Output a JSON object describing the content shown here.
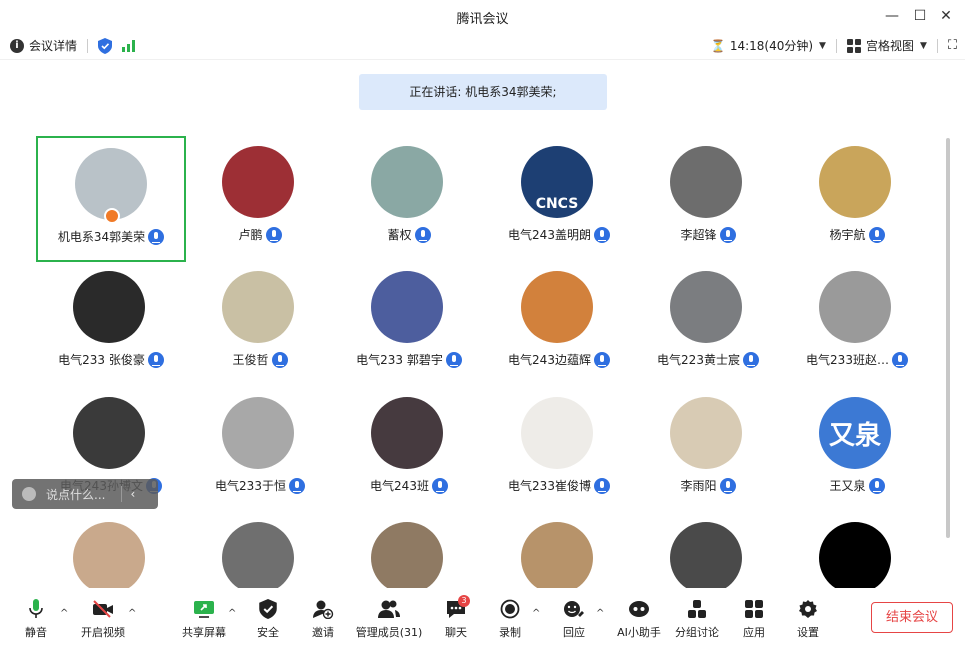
{
  "window": {
    "title": "腾讯会议",
    "minimize": "—",
    "maximize": "☐",
    "close": "✕"
  },
  "infobar": {
    "meeting_details": "会议详情",
    "timer": "14:18(40分钟)",
    "view_mode": "宫格视图"
  },
  "speaking_banner": "正在讲话: 机电系34郭美荣;",
  "participants": [
    {
      "name": "机电系34郭美荣",
      "avatar_color": "#b9c2c8",
      "host": true,
      "active": true
    },
    {
      "name": "卢鹏",
      "avatar_color": "#9d2f35"
    },
    {
      "name": "蓄权",
      "avatar_color": "#8aa8a4"
    },
    {
      "name": "电气243盖明朗",
      "avatar_color": "#1d3f73",
      "avatar_text": "CNCS"
    },
    {
      "name": "李超锋",
      "avatar_color": "#6d6d6d"
    },
    {
      "name": "杨宇航",
      "avatar_color": "#c9a55b"
    },
    {
      "name": "电气233 张俊豪",
      "avatar_color": "#2a2a2a"
    },
    {
      "name": "王俊哲",
      "avatar_color": "#c9c0a4"
    },
    {
      "name": "电气233 郭碧宇",
      "avatar_color": "#4d5e9e"
    },
    {
      "name": "电气243边蕴辉",
      "avatar_color": "#d2813c"
    },
    {
      "name": "电气223黄士宸",
      "avatar_color": "#7b7d80"
    },
    {
      "name": "电气233班赵…",
      "avatar_color": "#9a9a9a"
    },
    {
      "name": "电气243孙博文",
      "avatar_color": "#3a3a3a"
    },
    {
      "name": "电气233于恒",
      "avatar_color": "#a8a8a8"
    },
    {
      "name": "电气243班",
      "avatar_color": "#463a3f"
    },
    {
      "name": "电气233崔俊博",
      "avatar_color": "#eeece8"
    },
    {
      "name": "李雨阳",
      "avatar_color": "#d8cbb4"
    },
    {
      "name": "王又泉",
      "avatar_color": "#3c79d4",
      "avatar_text": "又泉"
    },
    {
      "name": "",
      "avatar_color": "#c9a98c"
    },
    {
      "name": "",
      "avatar_color": "#6f6f6f"
    },
    {
      "name": "",
      "avatar_color": "#8f7a63"
    },
    {
      "name": "",
      "avatar_color": "#b7936a"
    },
    {
      "name": "",
      "avatar_color": "#4a4a4a"
    },
    {
      "name": "",
      "avatar_color": "#000000"
    }
  ],
  "chat_float": {
    "placeholder": "说点什么..."
  },
  "toolbar": {
    "mute": "静音",
    "start_video": "开启视频",
    "share_screen": "共享屏幕",
    "security": "安全",
    "invite": "邀请",
    "manage_members": "管理成员(31)",
    "chat": "聊天",
    "chat_badge": "3",
    "record": "录制",
    "reactions": "回应",
    "ai_assistant": "AI小助手",
    "breakout": "分组讨论",
    "apps": "应用",
    "settings": "设置",
    "end_meeting": "结束会议"
  },
  "colors": {
    "accent": "#2f6fe0",
    "green": "#2bb24c",
    "danger": "#e64545",
    "banner": "#dce9fb"
  }
}
